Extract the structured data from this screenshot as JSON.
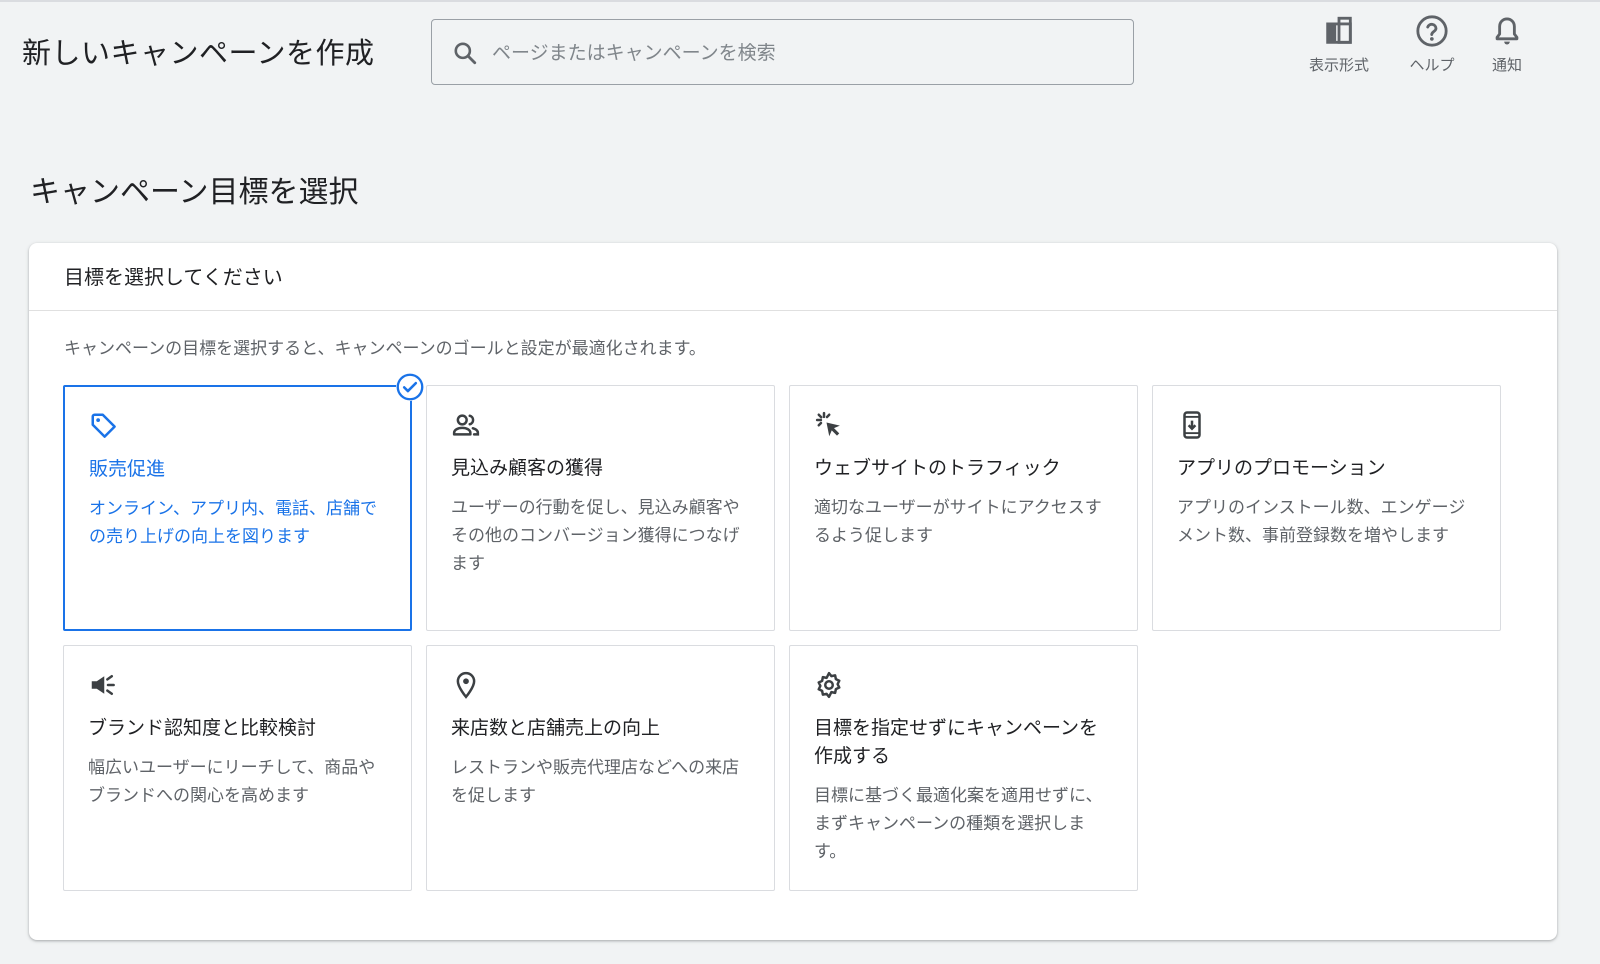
{
  "header": {
    "title": "新しいキャンペーンを作成",
    "search_placeholder": "ページまたはキャンペーンを検索",
    "tools": [
      {
        "label": "表示形式",
        "icon": "appearance-icon"
      },
      {
        "label": "ヘルプ",
        "icon": "help-icon"
      },
      {
        "label": "通知",
        "icon": "bell-icon"
      }
    ]
  },
  "section": {
    "title": "キャンペーン目標を選択"
  },
  "panel": {
    "heading": "目標を選択してください",
    "description": "キャンペーンの目標を選択すると、キャンペーンのゴールと設定が最適化されます。",
    "goals": [
      {
        "title": "販売促進",
        "description": "オンライン、アプリ内、電話、店舗での売り上げの向上を図ります",
        "icon": "tag-icon",
        "selected": true
      },
      {
        "title": "見込み顧客の獲得",
        "description": "ユーザーの行動を促し、見込み顧客やその他のコンバージョン獲得につなげます",
        "icon": "people-icon",
        "selected": false
      },
      {
        "title": "ウェブサイトのトラフィック",
        "description": "適切なユーザーがサイトにアクセスするよう促します",
        "icon": "click-icon",
        "selected": false
      },
      {
        "title": "アプリのプロモーション",
        "description": "アプリのインストール数、エンゲージメント数、事前登録数を増やします",
        "icon": "phone-download-icon",
        "selected": false
      },
      {
        "title": "ブランド認知度と比較検討",
        "description": "幅広いユーザーにリーチして、商品やブランドへの関心を高めます",
        "icon": "megaphone-icon",
        "selected": false
      },
      {
        "title": "来店数と店舗売上の向上",
        "description": "レストランや販売代理店などへの来店を促します",
        "icon": "location-pin-icon",
        "selected": false
      },
      {
        "title": "目標を指定せずにキャンペーンを作成する",
        "description": "目標に基づく最適化案を適用せずに、まずキャンペーンの種類を選択します。",
        "icon": "gear-icon",
        "selected": false
      }
    ]
  },
  "colors": {
    "accent": "#1a73e8",
    "background": "#f1f3f4",
    "text": "#202124",
    "muted": "#5f6368"
  }
}
